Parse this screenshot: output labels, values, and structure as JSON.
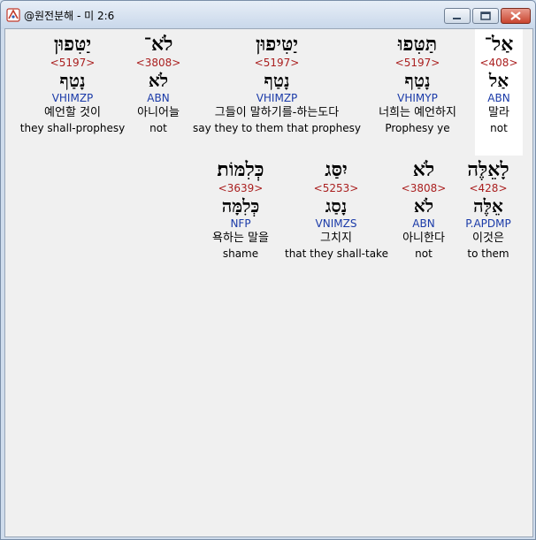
{
  "window": {
    "title": "@원전분해 - 미 2:6",
    "buttons": {
      "minimize": "minimize",
      "maximize": "maximize",
      "close": "close"
    }
  },
  "rows": [
    {
      "words": [
        {
          "hebrew": "יַטִּפוּן",
          "strong": "<5197>",
          "lemma": "נָטַף",
          "morph": "VHIMZP",
          "korean": "예언할 것이",
          "english": "they shall-prophesy"
        },
        {
          "hebrew": "לֹא־",
          "strong": "<3808>",
          "lemma": "לֹא",
          "morph": "ABN",
          "korean": "아니어늘",
          "english": "not"
        },
        {
          "hebrew": "יַטִּיפוּן",
          "strong": "<5197>",
          "lemma": "נָטַף",
          "morph": "VHIMZP",
          "korean": "그들이 말하기를-하는도다",
          "english": "say they to them that prophesy"
        },
        {
          "hebrew": "תַּטִּפוּ",
          "strong": "<5197>",
          "lemma": "נָטַף",
          "morph": "VHIMYP",
          "korean": "너희는 예언하지",
          "english": "Prophesy ye"
        },
        {
          "hebrew": "אַל־",
          "strong": "<408>",
          "lemma": "אַל",
          "morph": "ABN",
          "korean": "말라",
          "english": "not"
        }
      ]
    },
    {
      "words": [
        {
          "hebrew": "כְּלִמּוֹת׃",
          "strong": "<3639>",
          "lemma": "כְּלִמָּה",
          "morph": "NFP",
          "korean": "욕하는 말을",
          "english": "shame"
        },
        {
          "hebrew": "יִסַּג",
          "strong": "<5253>",
          "lemma": "נָסַג",
          "morph": "VNIMZS",
          "korean": "그치지",
          "english": "that they shall-take"
        },
        {
          "hebrew": "לֹא",
          "strong": "<3808>",
          "lemma": "לֹא",
          "morph": "ABN",
          "korean": "아니한다",
          "english": "not"
        },
        {
          "hebrew": "לָאֵלֶּה",
          "strong": "<428>",
          "lemma": "אֵלֶּה",
          "morph": "P.APDMP",
          "korean": "이것은",
          "english": "to them"
        }
      ]
    }
  ]
}
